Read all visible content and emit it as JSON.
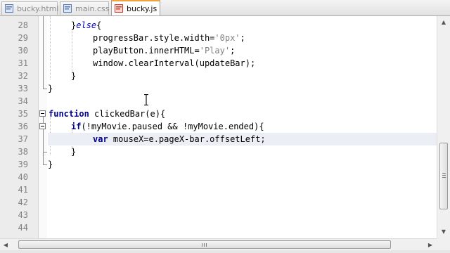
{
  "tabs": [
    {
      "label": "bucky.html",
      "icon": "html-file-icon",
      "active": false
    },
    {
      "label": "main.css",
      "icon": "css-file-icon",
      "active": false
    },
    {
      "label": "bucky.js",
      "icon": "js-file-icon",
      "active": true
    }
  ],
  "editor": {
    "line_numbers": [
      "28",
      "29",
      "30",
      "31",
      "32",
      "33",
      "34",
      "35",
      "36",
      "37",
      "38",
      "39",
      "40",
      "41",
      "42",
      "43",
      "44"
    ],
    "lines": {
      "l28": {
        "brace": "}",
        "keyword": "else",
        "rest": "{"
      },
      "l29": {
        "before": "progressBar.style.width=",
        "string": "'0px'",
        "after": ";"
      },
      "l30": {
        "before": "playButton.innerHTML=",
        "string": "'Play'",
        "after": ";"
      },
      "l31": {
        "code": "window.clearInterval(updateBar);"
      },
      "l32": {
        "code": "}"
      },
      "l33": {
        "code": "}"
      },
      "l35": {
        "keyword": "function",
        "rest": " clickedBar(e){"
      },
      "l36": {
        "keyword": "if",
        "rest": "(!myMovie.paused && !myMovie.ended){"
      },
      "l37": {
        "keyword": "var",
        "rest": " mouseX=e.pageX-bar.offsetLeft;"
      },
      "l38": {
        "code": "}"
      },
      "l39": {
        "code": "}"
      }
    },
    "current_line": "37"
  },
  "colors": {
    "keyword": "#0000cc",
    "string": "#808080",
    "current_line_bg": "#eceef6",
    "active_tab_accent": "#f0a33e"
  }
}
